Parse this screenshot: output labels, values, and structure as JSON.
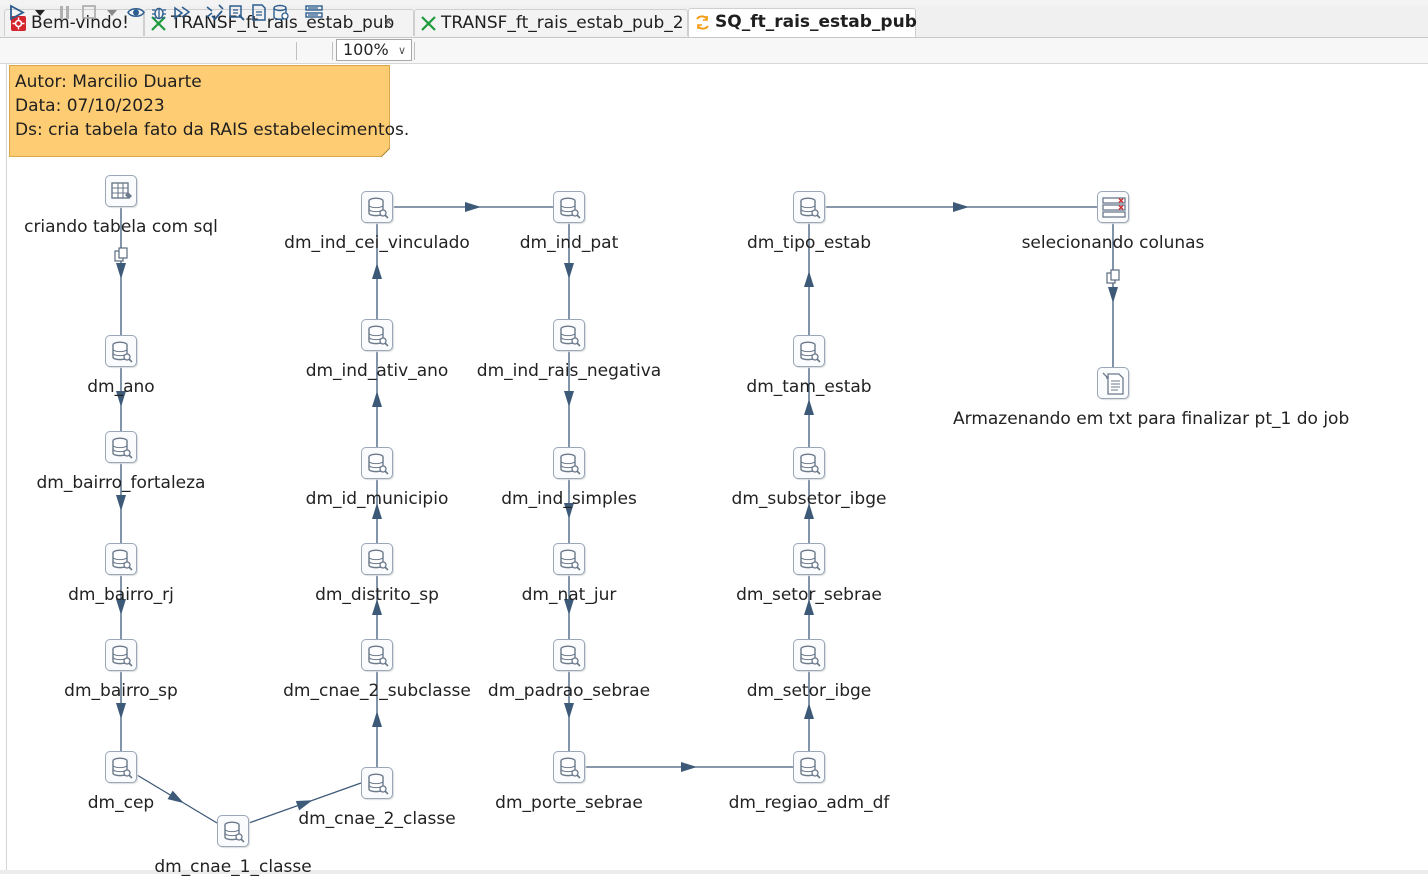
{
  "tabs": [
    {
      "label": "Bem-vindo!",
      "icon": "welcome-icon"
    },
    {
      "label": "TRANSF_ft_rais_estab_pub",
      "icon": "transformation-icon",
      "close": "⨯"
    },
    {
      "label": "TRANSF_ft_rais_estab_pub_2",
      "icon": "transformation-icon"
    },
    {
      "label": "SQ_ft_rais_estab_pub",
      "icon": "job-icon",
      "active": true
    }
  ],
  "toolbar": {
    "zoom": "100%",
    "buttons": [
      "run-icon",
      "run-dropdown-icon",
      "pause-icon",
      "stop-icon",
      "stop-dropdown-icon",
      "preview-icon",
      "debug-icon",
      "replay-icon",
      "verify-icon",
      "impact-icon",
      "sql-icon",
      "explore-db-icon",
      "show-results-icon"
    ]
  },
  "note": {
    "line1": "Autor: Marcilio Duarte",
    "line2": "Data: 07/10/2023",
    "line3": "Ds: cria tabela fato da RAIS estabelecimentos."
  },
  "colors": {
    "note_bg": "#fecc73",
    "hop": "#3d5a78",
    "icon": "#6b7a8c"
  },
  "steps": {
    "criando_tabela": "criando tabela com sql",
    "dm_ano": "dm_ano",
    "dm_bairro_fortaleza": "dm_bairro_fortaleza",
    "dm_bairro_rj": "dm_bairro_rj",
    "dm_bairro_sp": "dm_bairro_sp",
    "dm_cep": "dm_cep",
    "dm_cnae_1_classe": "dm_cnae_1_classe",
    "dm_cnae_2_classe": "dm_cnae_2_classe",
    "dm_cnae_2_subclasse": "dm_cnae_2_subclasse",
    "dm_distrito_sp": "dm_distrito_sp",
    "dm_id_municipio": "dm_id_municipio",
    "dm_ind_ativ_ano": "dm_ind_ativ_ano",
    "dm_ind_cei_vinculado": "dm_ind_cei_vinculado",
    "dm_ind_pat": "dm_ind_pat",
    "dm_ind_rais_negativa": "dm_ind_rais_negativa",
    "dm_ind_simples": "dm_ind_simples",
    "dm_nat_jur": "dm_nat_jur",
    "dm_padrao_sebrae": "dm_padrao_sebrae",
    "dm_porte_sebrae": "dm_porte_sebrae",
    "dm_regiao_adm_df": "dm_regiao_adm_df",
    "dm_setor_ibge": "dm_setor_ibge",
    "dm_setor_sebrae": "dm_setor_sebrae",
    "dm_subsetor_ibge": "dm_subsetor_ibge",
    "dm_tam_estab": "dm_tam_estab",
    "dm_tipo_estab": "dm_tipo_estab",
    "selecionando_colunas": "selecionando colunas",
    "armazenando": "Armazenando em txt para finalizar pt_1 do job"
  }
}
